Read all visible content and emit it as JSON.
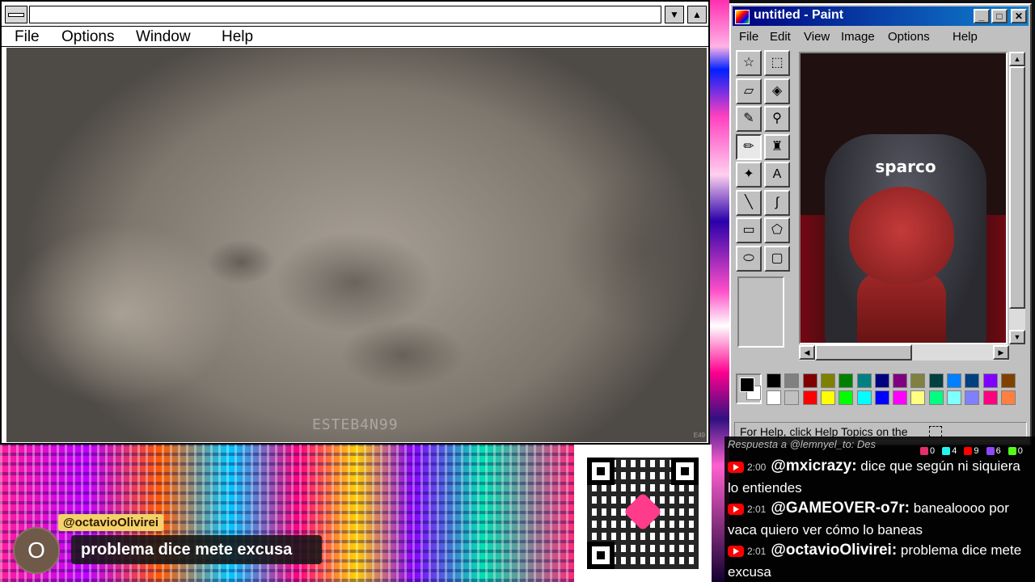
{
  "left_window": {
    "menu": [
      "File",
      "Options",
      "Window",
      "Help"
    ],
    "minimize_glyph": "▼",
    "maximize_glyph": "▲",
    "watermark": "ESTEB4N99",
    "corner_tag": "E49"
  },
  "paint": {
    "title": "untitled - Paint",
    "menu": [
      "File",
      "Edit",
      "View",
      "Image",
      "Options",
      "Help"
    ],
    "window_buttons": {
      "minimize": "_",
      "maximize": "□",
      "close": "✕"
    },
    "tools": [
      {
        "name": "free-select-icon",
        "glyph": "☆"
      },
      {
        "name": "select-icon",
        "glyph": "⬚"
      },
      {
        "name": "eraser-icon",
        "glyph": "▱"
      },
      {
        "name": "fill-icon",
        "glyph": "◈"
      },
      {
        "name": "color-picker-icon",
        "glyph": "✎"
      },
      {
        "name": "magnifier-icon",
        "glyph": "⚲"
      },
      {
        "name": "pencil-icon",
        "glyph": "✏"
      },
      {
        "name": "brush-icon",
        "glyph": "♜"
      },
      {
        "name": "airbrush-icon",
        "glyph": "✦"
      },
      {
        "name": "text-icon",
        "glyph": "A"
      },
      {
        "name": "line-icon",
        "glyph": "╲"
      },
      {
        "name": "curve-icon",
        "glyph": "∫"
      },
      {
        "name": "rectangle-icon",
        "glyph": "▭"
      },
      {
        "name": "polygon-icon",
        "glyph": "⬠"
      },
      {
        "name": "ellipse-icon",
        "glyph": "⬭"
      },
      {
        "name": "rounded-rect-icon",
        "glyph": "▢"
      }
    ],
    "canvas_chair_text": "sparco",
    "palette_top": [
      "#000000",
      "#808080",
      "#800000",
      "#808000",
      "#008000",
      "#008080",
      "#000080",
      "#800080",
      "#808040",
      "#004040",
      "#0080ff",
      "#004080",
      "#8000ff",
      "#804000"
    ],
    "palette_bottom": [
      "#ffffff",
      "#c0c0c0",
      "#ff0000",
      "#ffff00",
      "#00ff00",
      "#00ffff",
      "#0000ff",
      "#ff00ff",
      "#ffff80",
      "#00ff80",
      "#80ffff",
      "#8080ff",
      "#ff0080",
      "#ff8040"
    ],
    "status": "For Help, click Help Topics on the"
  },
  "overlay": {
    "username": "@octavioOlivirei",
    "message": "problema dice mete excusa",
    "avatar_letter": "O"
  },
  "chat": {
    "truncated_line": "Respuesta a @lemnyel_to: Des",
    "stats": [
      "0",
      "4",
      "9",
      "6",
      "0"
    ],
    "messages": [
      {
        "time": "2:00",
        "user": "@mxicrazy:",
        "text": "dice que según ni siquiera lo entiendes"
      },
      {
        "time": "2:01",
        "user": "@GAMEOVER-o7r:",
        "text": "banealoooo por vaca quiero ver cómo lo baneas"
      },
      {
        "time": "2:01",
        "user": "@octavioOlivirei:",
        "text": "problema dice mete excusa"
      }
    ]
  }
}
